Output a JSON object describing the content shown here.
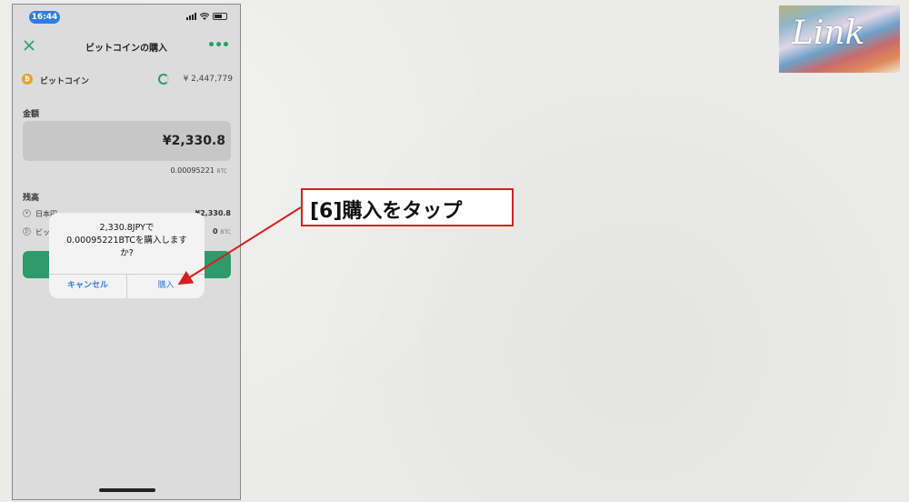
{
  "status": {
    "time": "16:44"
  },
  "nav": {
    "title": "ビットコインの購入"
  },
  "coin": {
    "icon_glyph": "₿",
    "name": "ビットコイン",
    "price": "¥ 2,447,779"
  },
  "amount": {
    "label": "金額",
    "value": "¥2,330.8",
    "btc_value": "0.00095221",
    "btc_unit": "BTC"
  },
  "balance": {
    "label": "残高",
    "rows": [
      {
        "icon": "¥",
        "name": "日本円",
        "value": "¥2,330.8",
        "unit": ""
      },
      {
        "icon": "₿",
        "name": "ビッ",
        "value": "0",
        "unit": "BTC"
      }
    ]
  },
  "dialog": {
    "line1": "2,330.8JPYで",
    "line2": "0.00095221BTCを購入します",
    "line3": "か?",
    "cancel_label": "キャンセル",
    "confirm_label": "購入"
  },
  "callout": {
    "text": "[6]購入をタップ"
  },
  "logo": {
    "text": "Link"
  },
  "colors": {
    "accent_green": "#2a9d6a",
    "ios_blue": "#2f7de1",
    "callout_red": "#d42020"
  }
}
